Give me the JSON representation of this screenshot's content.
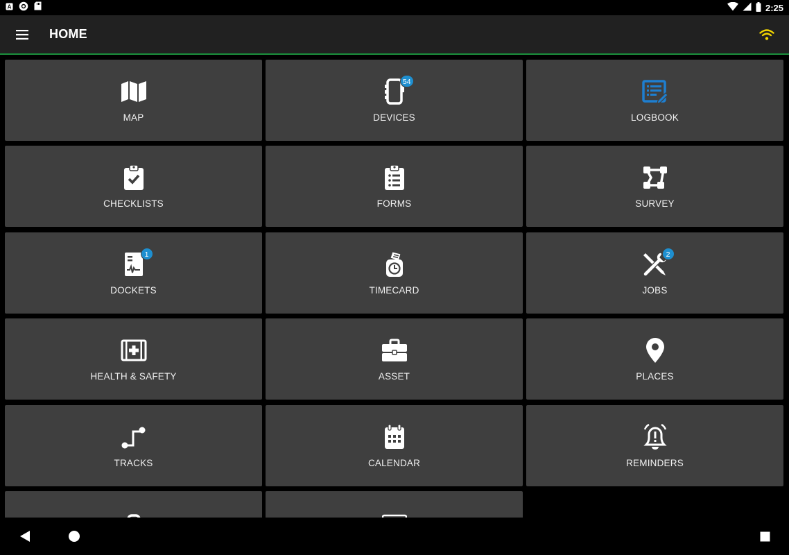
{
  "status_bar": {
    "time": "2:25",
    "icons": [
      "a-notification-icon",
      "circle-notification-icon",
      "sd-card-icon",
      "wifi-signal-icon",
      "cell-signal-icon",
      "battery-icon"
    ]
  },
  "app_bar": {
    "title": "HOME",
    "menu_icon": "hamburger-menu-icon",
    "status_icon": "wifi-icon",
    "status_icon_color": "#f2d600"
  },
  "colors": {
    "tile_bg": "#3f3f3f",
    "badge": "#1e8fd0",
    "accent_line": "#1b8f3c",
    "logbook_icon": "#1e7fd0"
  },
  "tiles": [
    {
      "label": "MAP",
      "icon": "map-icon",
      "badge": ""
    },
    {
      "label": "DEVICES",
      "icon": "device-icon",
      "badge": "54"
    },
    {
      "label": "LOGBOOK",
      "icon": "logbook-icon",
      "badge": ""
    },
    {
      "label": "CHECKLISTS",
      "icon": "clipboard-check-icon",
      "badge": ""
    },
    {
      "label": "FORMS",
      "icon": "clipboard-list-icon",
      "badge": ""
    },
    {
      "label": "SURVEY",
      "icon": "vector-square-icon",
      "badge": ""
    },
    {
      "label": "DOCKETS",
      "icon": "docket-icon",
      "badge": "1"
    },
    {
      "label": "TIMECARD",
      "icon": "timecard-icon",
      "badge": ""
    },
    {
      "label": "JOBS",
      "icon": "tools-icon",
      "badge": "2"
    },
    {
      "label": "HEALTH & SAFETY",
      "icon": "first-aid-icon",
      "badge": ""
    },
    {
      "label": "ASSET",
      "icon": "toolbox-icon",
      "badge": ""
    },
    {
      "label": "PLACES",
      "icon": "map-pin-icon",
      "badge": ""
    },
    {
      "label": "TRACKS",
      "icon": "track-icon",
      "badge": ""
    },
    {
      "label": "CALENDAR",
      "icon": "calendar-icon",
      "badge": ""
    },
    {
      "label": "REMINDERS",
      "icon": "bell-alert-icon",
      "badge": ""
    },
    {
      "label": "",
      "icon": "partial-icon-1",
      "badge": ""
    },
    {
      "label": "",
      "icon": "partial-icon-2",
      "badge": ""
    }
  ],
  "nav_bar": {
    "back": "back-triangle-icon",
    "home": "home-circle-icon",
    "recents": "recents-square-icon"
  }
}
